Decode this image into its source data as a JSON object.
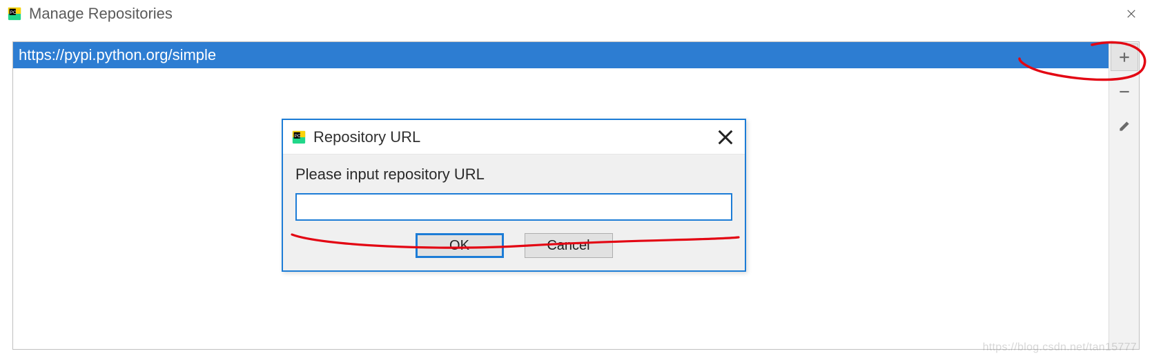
{
  "window": {
    "title": "Manage Repositories"
  },
  "repositories": {
    "items": [
      {
        "url": "https://pypi.python.org/simple"
      }
    ]
  },
  "tools": {
    "add": {
      "name": "plus-icon"
    },
    "remove": {
      "name": "minus-icon"
    },
    "edit": {
      "name": "pencil-icon"
    }
  },
  "dialog": {
    "title": "Repository URL",
    "label": "Please input repository URL",
    "input_value": "",
    "ok_label": "OK",
    "cancel_label": "Cancel"
  },
  "watermark": "https://blog.csdn.net/tan15777"
}
